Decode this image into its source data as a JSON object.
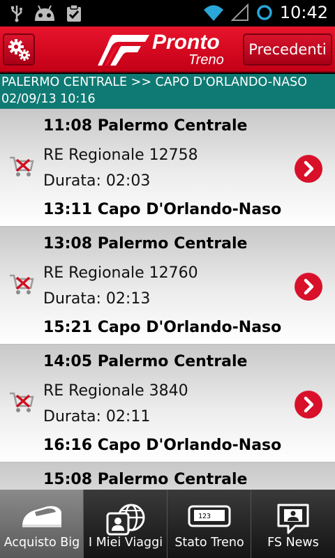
{
  "status_bar": {
    "time": "10:42",
    "icons": [
      "usb-icon",
      "android-debug-icon",
      "clipboard-check-icon",
      "wifi-icon",
      "cell-signal-icon",
      "sync-ring-icon"
    ]
  },
  "header": {
    "logo_title": "Pronto",
    "logo_subtitle": "Treno",
    "previous_label": "Precedenti",
    "brand_color": "#d8142c"
  },
  "route": {
    "line1": "PALERMO CENTRALE >> CAPO D'ORLANDO-NASO",
    "line2": "02/09/13 10:16"
  },
  "results": [
    {
      "departure": "11:08 Palermo Centrale",
      "train": "RE Regionale 12758",
      "duration": "Durata: 02:03",
      "arrival": "13:11 Capo D'Orlando-Naso"
    },
    {
      "departure": "13:08 Palermo Centrale",
      "train": "RE Regionale 12760",
      "duration": "Durata: 02:13",
      "arrival": "15:21 Capo D'Orlando-Naso"
    },
    {
      "departure": "14:05 Palermo Centrale",
      "train": "RE Regionale 3840",
      "duration": "Durata: 02:11",
      "arrival": "16:16 Capo D'Orlando-Naso"
    },
    {
      "departure": "15:08 Palermo Centrale",
      "train": "",
      "duration": "",
      "arrival": ""
    }
  ],
  "tabs": [
    {
      "label": "Acquisto Big",
      "icon": "train-icon",
      "active": true
    },
    {
      "label": "I Miei Viaggi",
      "icon": "globe-profile-icon",
      "active": false
    },
    {
      "label": "Stato Treno",
      "icon": "train-number-icon",
      "number": "123",
      "active": false
    },
    {
      "label": "FS News",
      "icon": "news-chat-icon",
      "active": false
    }
  ]
}
